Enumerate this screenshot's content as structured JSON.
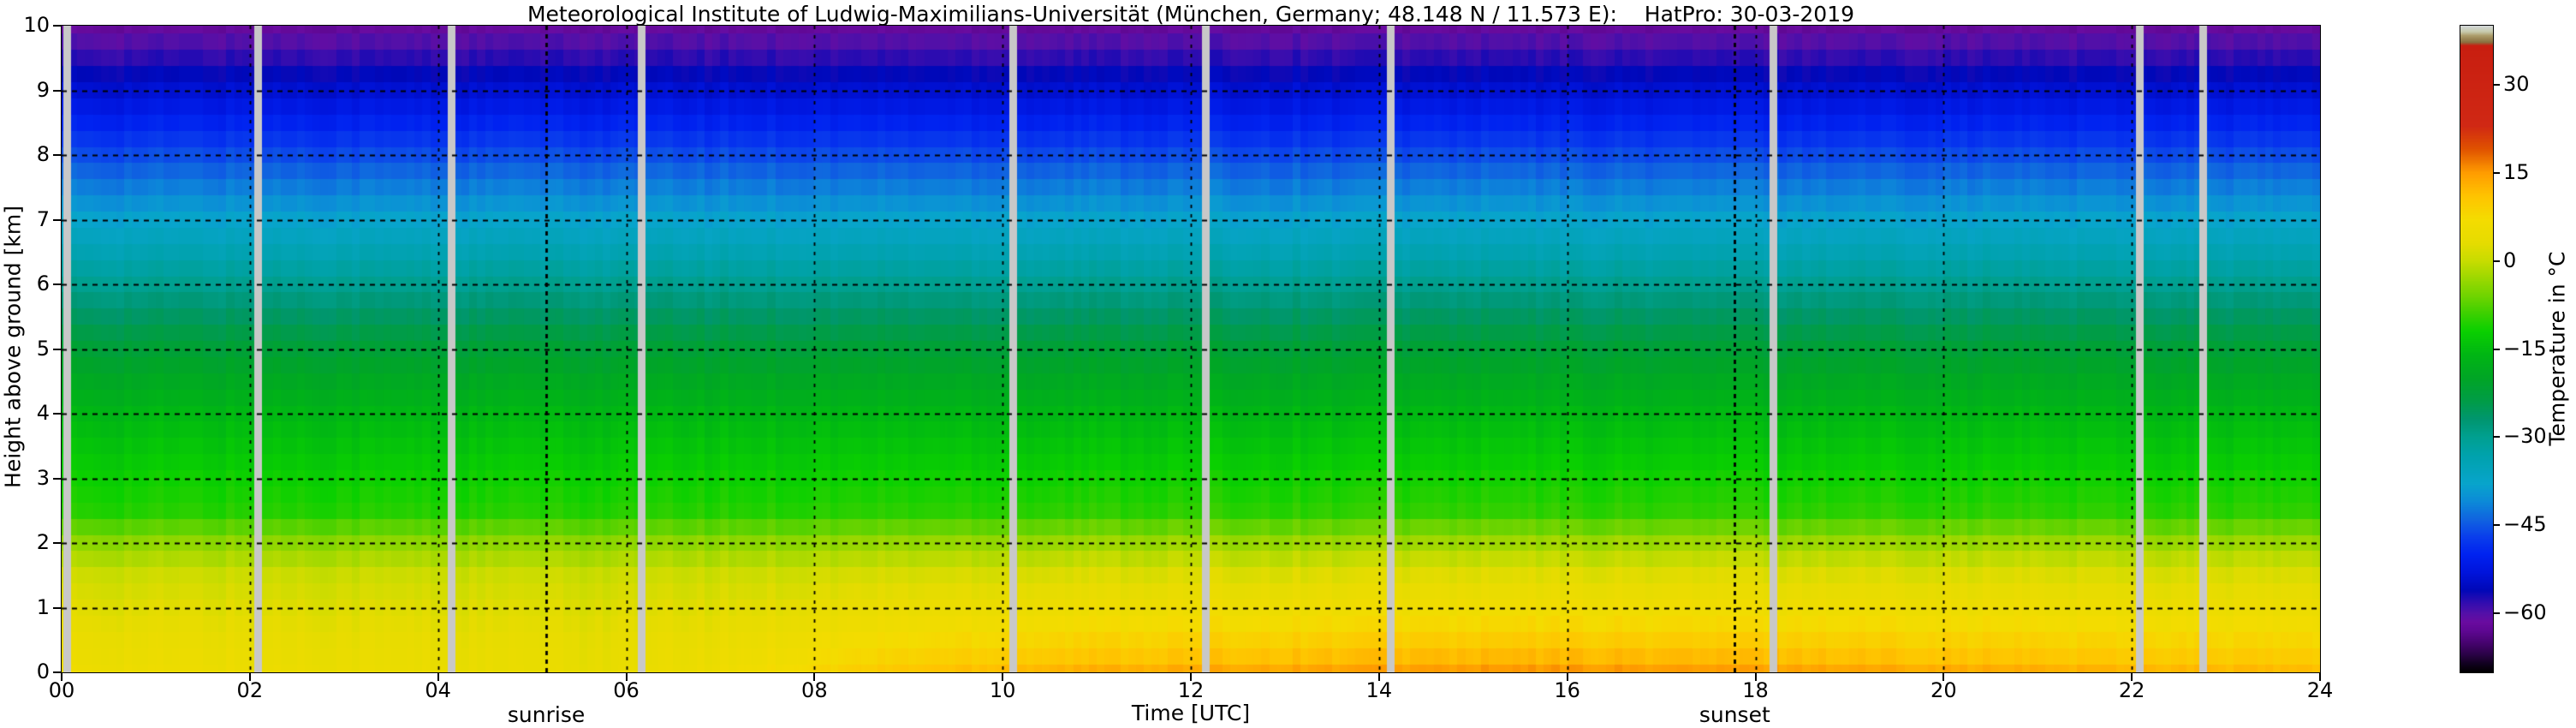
{
  "title": "Meteorological Institute of Ludwig-Maximilians-Universität (München, Germany; 48.148 N / 11.573 E):    HatPro: 30-03-2019",
  "axes": {
    "x_label": "Time [UTC]",
    "y_label": "Height above ground [km]",
    "x_tick_labels": [
      "00",
      "02",
      "04",
      "06",
      "08",
      "10",
      "12",
      "14",
      "16",
      "18",
      "20",
      "22",
      "24"
    ],
    "y_tick_labels": [
      "0",
      "1",
      "2",
      "3",
      "4",
      "5",
      "6",
      "7",
      "8",
      "9",
      "10"
    ]
  },
  "colorbar": {
    "label": "Temperature in °C",
    "vmin": -70,
    "vmax": 40,
    "ticks": [
      {
        "value": 30,
        "label": "30"
      },
      {
        "value": 15,
        "label": "15"
      },
      {
        "value": 0,
        "label": "0"
      },
      {
        "value": -15,
        "label": "−15"
      },
      {
        "value": -30,
        "label": "−30"
      },
      {
        "value": -45,
        "label": "−45"
      },
      {
        "value": -60,
        "label": "−60"
      }
    ]
  },
  "chart_data": {
    "type": "heatmap",
    "x_range_hours": [
      0,
      24
    ],
    "y_range_km": [
      0,
      10
    ],
    "x_tick_step_hours": 2,
    "y_tick_step_km": 1,
    "grid": "dashed black lines every 1 km and every 2 h",
    "colormap_value_to_hex": [
      [
        -70,
        "#000000"
      ],
      [
        -68.5,
        "#120120"
      ],
      [
        -67,
        "#2a0246"
      ],
      [
        -65,
        "#46036f"
      ],
      [
        -63,
        "#5e0792"
      ],
      [
        -61.5,
        "#6a0ba0"
      ],
      [
        -60,
        "#5410a8"
      ],
      [
        -58,
        "#2e0cb0"
      ],
      [
        -56,
        "#0008b8"
      ],
      [
        -53,
        "#0014dc"
      ],
      [
        -50,
        "#0022f0"
      ],
      [
        -47,
        "#0a3eec"
      ],
      [
        -44,
        "#1064e0"
      ],
      [
        -41,
        "#0c8ad8"
      ],
      [
        -38,
        "#08a4cc"
      ],
      [
        -33,
        "#00a2ac"
      ],
      [
        -30,
        "#00a090"
      ],
      [
        -27,
        "#009670"
      ],
      [
        -24,
        "#009c48"
      ],
      [
        -20,
        "#00a526"
      ],
      [
        -16,
        "#00b614"
      ],
      [
        -12,
        "#0ad000"
      ],
      [
        -9,
        "#3cd000"
      ],
      [
        -6,
        "#70d400"
      ],
      [
        -3,
        "#9cd800"
      ],
      [
        0,
        "#c8dc00"
      ],
      [
        3,
        "#e6dc00"
      ],
      [
        7,
        "#f4dc00"
      ],
      [
        11,
        "#ffc400"
      ],
      [
        15,
        "#ff9c00"
      ],
      [
        19,
        "#e05200"
      ],
      [
        23,
        "#d02814"
      ],
      [
        36.6,
        "#c81e10"
      ],
      [
        37.2,
        "#8a7040"
      ],
      [
        38.3,
        "#ac9c6a"
      ],
      [
        39,
        "#c8ccae"
      ],
      [
        40,
        "#d2d6da"
      ]
    ],
    "profile_heights_km": [
      0,
      0.5,
      1,
      1.5,
      2,
      2.5,
      3,
      3.5,
      4,
      4.5,
      5,
      5.5,
      6,
      6.5,
      7,
      7.5,
      8,
      8.5,
      9,
      9.5,
      10
    ],
    "base_profile_C": [
      5,
      4,
      2.5,
      0.5,
      -4,
      -10.5,
      -12,
      -14,
      -16,
      -19,
      -22,
      -26,
      -30,
      -34,
      -38,
      -42,
      -46,
      -50,
      -54,
      -58,
      -62
    ],
    "diurnal_surface_warming": {
      "hours": [
        0,
        2,
        4,
        5,
        6,
        7,
        8,
        9,
        10,
        11,
        12,
        14,
        16,
        18,
        20,
        22,
        24
      ],
      "delta_C": [
        0,
        -0.5,
        -1,
        -1.5,
        -1.5,
        0,
        3,
        5.5,
        7,
        8,
        8.5,
        9.5,
        10,
        9.5,
        8.5,
        7.5,
        6.5
      ],
      "decay_height_km": 0.9
    },
    "gap_stripes_hours": [
      0.02,
      2.05,
      4.1,
      6.12,
      10.07,
      12.12,
      14.08,
      18.15,
      22.04,
      22.72
    ],
    "gap_stripe_color": "#c8c8c8",
    "sun_lines": [
      {
        "label": "sunrise",
        "hour": 5.15
      },
      {
        "label": "sunset",
        "hour": 17.78
      }
    ]
  }
}
